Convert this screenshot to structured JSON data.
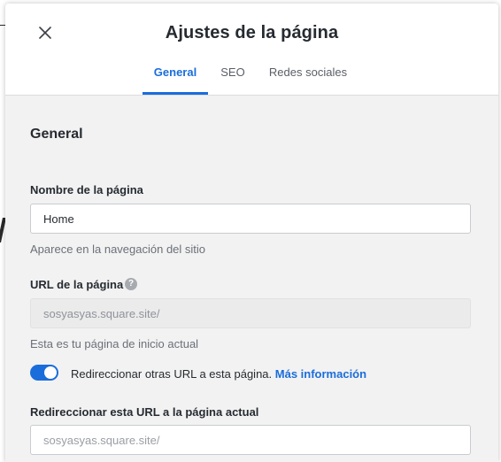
{
  "modal": {
    "title": "Ajustes de la página",
    "close_icon": "close-icon"
  },
  "tabs": [
    {
      "label": "General",
      "active": true
    },
    {
      "label": "SEO",
      "active": false
    },
    {
      "label": "Redes sociales",
      "active": false
    }
  ],
  "section": {
    "title": "General"
  },
  "page_name": {
    "label": "Nombre de la página",
    "value": "Home",
    "help": "Aparece en la navegación del sitio"
  },
  "page_url": {
    "label": "URL de la página",
    "info_icon": "question-mark-icon",
    "info_glyph": "?",
    "value": "sosyasyas.square.site/",
    "help": "Esta es tu página de inicio actual"
  },
  "redirect_toggle": {
    "on": true,
    "text": "Redireccionar otras URL a esta página.",
    "link": "Más información"
  },
  "redirect_url": {
    "label": "Redireccionar esta URL a la página actual",
    "placeholder": "sosyasyas.square.site/"
  },
  "colors": {
    "accent": "#1a6ddb",
    "text": "#262b31",
    "muted": "#6b7078"
  }
}
